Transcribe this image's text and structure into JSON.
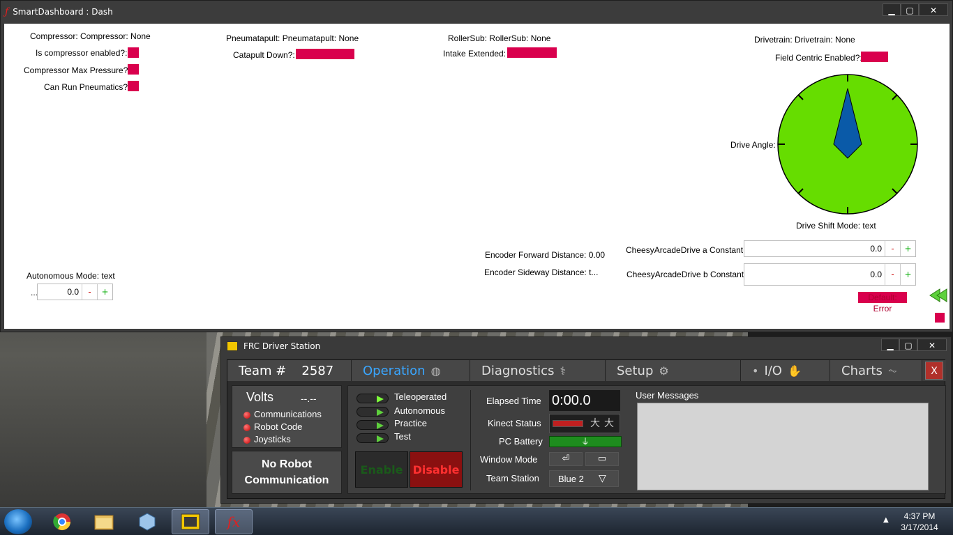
{
  "smartdashboard": {
    "title": "SmartDashboard : Dash",
    "compressor_header": "Compressor: Compressor: None",
    "compressor_enabled_label": "Is compressor enabled?:",
    "compressor_max_label": "Compressor Max Pressure?:",
    "can_run_pneumatics_label": "Can Run Pneumatics?:",
    "pneumatapult_header": "Pneumatapult: Pneumatapult: None",
    "catapult_down_label": "Catapult Down?:",
    "rollersub_header": "RollerSub: RollerSub: None",
    "intake_extended_label": "Intake Extended:",
    "drivetrain_header": "Drivetrain: Drivetrain: None",
    "field_centric_label": "Field Centric Enabled?:",
    "drive_angle_label": "Drive Angle:",
    "drive_shift_label": "Drive Shift Mode: text",
    "encoder_forward_label": "Encoder Forward Distance: 0.00",
    "encoder_sideway_label": "Encoder Sideway Distance: t...",
    "cheesy_a_label": "CheesyArcadeDrive a Constant:",
    "cheesy_a_value": "0.0",
    "cheesy_b_label": "CheesyArcadeDrive b Constant:",
    "cheesy_b_value": "0.0",
    "autonomous_mode_label": "Autonomous Mode: text",
    "autonomous_prefix": "...",
    "autonomous_value": "0.0",
    "minus_label": "-",
    "plus_label": "+",
    "default_error_text": "Default: Error",
    "bool_color": "#d9004d",
    "gauge_color": "#66dd00",
    "needle_color": "#0a5aa8"
  },
  "driver_station": {
    "title": "FRC Driver Station",
    "team_label": "Team #",
    "team_number": "2587",
    "tabs": {
      "operation": "Operation",
      "diagnostics": "Diagnostics",
      "setup": "Setup",
      "io": "I/O",
      "charts": "Charts"
    },
    "close_label": "X",
    "volts_label": "Volts",
    "volts_value": "--.--",
    "communications_label": "Communications",
    "robot_code_label": "Robot Code",
    "joysticks_label": "Joysticks",
    "no_robot_line1": "No Robot",
    "no_robot_line2": "Communication",
    "modes": [
      "Teleoperated",
      "Autonomous",
      "Practice",
      "Test"
    ],
    "enable_label": "Enable",
    "disable_label": "Disable",
    "elapsed_time_label": "Elapsed Time",
    "elapsed_time_value": "0:00.0",
    "kinect_status_label": "Kinect Status",
    "pc_battery_label": "PC Battery",
    "window_mode_label": "Window Mode",
    "team_station_label": "Team Station",
    "team_station_value": "Blue 2",
    "user_messages_label": "User Messages"
  },
  "taskbar": {
    "time": "4:37 PM",
    "date": "3/17/2014",
    "sd_label": "fx"
  }
}
